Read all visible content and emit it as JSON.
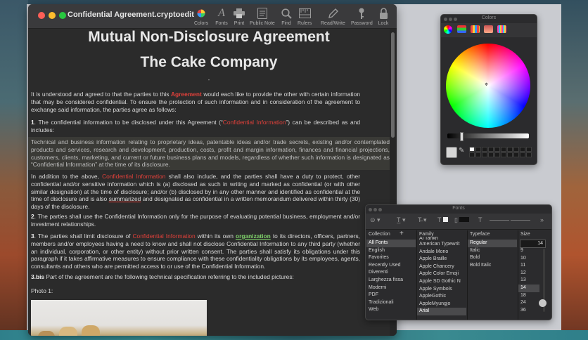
{
  "editor": {
    "doc_title": "Confidential Agreement.cryptoedit",
    "toolbar": [
      {
        "label": "Colors",
        "icon": "color-wheel-icon"
      },
      {
        "label": "Fonts",
        "icon": "font-icon"
      },
      {
        "label": "Print",
        "icon": "printer-icon"
      },
      {
        "label": "Public Note",
        "icon": "note-icon"
      },
      {
        "label": "Find",
        "icon": "magnifier-icon"
      },
      {
        "label": "Rulers",
        "icon": "ruler-icon"
      },
      {
        "label": "Read/Write",
        "icon": "pencil-icon"
      },
      {
        "label": "Password",
        "icon": "key-icon"
      },
      {
        "label": "Lock",
        "icon": "lock-icon"
      }
    ],
    "heading1": "Mutual Non-Disclosure Agreement",
    "heading2": "The Cake Company",
    "dash": "-",
    "p1_a": "It is understood and agreed to that the parties to this ",
    "p1_agreement": "Agreement",
    "p1_b": " would each like to provide the other with certain information that may be considered confidential. To ensure the protection of such information and in consideration of the agreement to exchange said information, the parties agree as follows:",
    "p2_num": "1",
    "p2_a": ". The confidential information to be disclosed under this Agreement (“",
    "p2_ci": "Confidential Information",
    "p2_b": "”) can be described as and includes:",
    "p3": "Technical and business information relating to proprietary ideas, patentable ideas and/or trade secrets, existing and/or contemplated products and services, research and development, production, costs, profit and margin information, finances and financial projections, customers, clients, marketing, and current or future business plans and models, regardless of whether such information is designated as “Confidential Information” at the time of its disclosure.",
    "p4_a": "In addition to the above, ",
    "p4_ci": "Confidential Information",
    "p4_b": " shall also include, and the parties shall have a duty to protect, other confidential and/or sensitive information which is (a) disclosed as such in writing and marked as confidential (or with other similar designation) at the time of disclosure; and/or (b) disclosed by in any other manner and identified as confidential at the time of disclosure and is also ",
    "p4_sum": "summarized",
    "p4_c": " and designated as confidential in a written memorandum delivered within thirty (30) days of the disclosure.",
    "p5_num": "2",
    "p5": ". The parties shall use the Confidential Information only for the purpose of evaluating potential business, employment and/or investment relationships.",
    "p6_num": "3",
    "p6_a": ". The parties shall limit disclosure of ",
    "p6_ci": "Confidential Information",
    "p6_b": " within its own ",
    "p6_org": "organization",
    "p6_c": " to its directors, officers, partners, members and/or employees having a need to know and shall not disclose Confidential Information to any third party (whether an individual, corporation, or other entity) without prior written consent. The parties shall satisfy its obligations under this paragraph if it takes affirmative measures to ensure compliance with these confidentiality obligations by its employees, agents, consultants and others who are permitted access to or use of the Confidential Information.",
    "p7_num": "3.bis",
    "p7": "  Part of the agreement are the following technical specification referring to the included pictures:",
    "p8": "Photo 1:"
  },
  "colors_panel": {
    "title": "Colors"
  },
  "fonts_panel": {
    "title": "Fonts",
    "headers": {
      "collection": "Collection",
      "family": "Family",
      "typeface": "Typeface",
      "size": "Size"
    },
    "collections": [
      "All Fonts",
      "English",
      "Favorites",
      "Recently Used",
      "Diverenti",
      "Larghezza fissa",
      "Moderni",
      "PDF",
      "Tradizionali",
      "Web"
    ],
    "families": [
      "Al Tarikh",
      "American Typewrit",
      "Andale Mono",
      "Apple Braille",
      "Apple Chancery",
      "Apple Color Emoji",
      "Apple SD Gothic N",
      "Apple Symbols",
      "AppleGothic",
      "AppleMyungjo",
      "Arial"
    ],
    "typefaces": [
      "Regular",
      "Italic",
      "Bold",
      "Bold Italic"
    ],
    "size_value": "14",
    "sizes": [
      "9",
      "10",
      "11",
      "12",
      "13",
      "14",
      "18",
      "24",
      "36"
    ]
  },
  "colors": {
    "accent_red": "#e0403a",
    "accent_green": "#7fd16a"
  }
}
